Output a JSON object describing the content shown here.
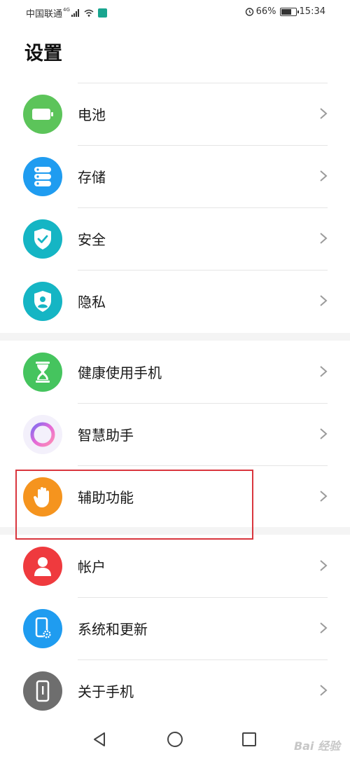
{
  "status_bar": {
    "carrier": "中国联通",
    "network": "4G",
    "battery": "66%",
    "time": "15:34"
  },
  "page": {
    "title": "设置"
  },
  "groups": [
    {
      "items": [
        {
          "label": "电池",
          "icon": "battery-icon",
          "color": "#5cc45a"
        },
        {
          "label": "存储",
          "icon": "storage-icon",
          "color": "#1f9cf0"
        },
        {
          "label": "安全",
          "icon": "shield-check-icon",
          "color": "#15b5c4"
        },
        {
          "label": "隐私",
          "icon": "privacy-icon",
          "color": "#15b5c4"
        }
      ]
    },
    {
      "items": [
        {
          "label": "健康使用手机",
          "icon": "hourglass-icon",
          "color": "#45c45e"
        },
        {
          "label": "智慧助手",
          "icon": "assistant-ring-icon",
          "color": "#f3f0fb"
        },
        {
          "label": "辅助功能",
          "icon": "hand-icon",
          "color": "#f5941e"
        }
      ]
    },
    {
      "items": [
        {
          "label": "帐户",
          "icon": "account-icon",
          "color": "#ef3a3e"
        },
        {
          "label": "系统和更新",
          "icon": "phone-settings-icon",
          "color": "#1f9cf0"
        },
        {
          "label": "关于手机",
          "icon": "phone-info-icon",
          "color": "#6e6e6e"
        }
      ]
    }
  ],
  "watermark": "Bai 经验"
}
